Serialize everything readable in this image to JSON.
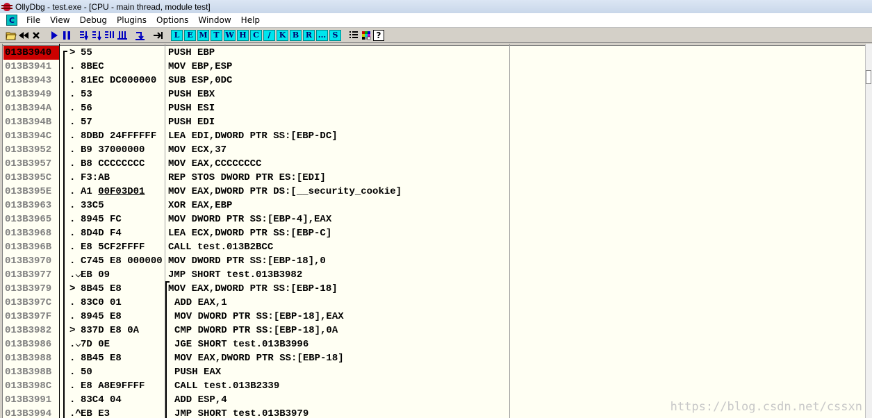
{
  "window": {
    "title": "OllyDbg - test.exe - [CPU - main thread, module test]"
  },
  "menu": {
    "logo": "C",
    "items": [
      "File",
      "View",
      "Debug",
      "Plugins",
      "Options",
      "Window",
      "Help"
    ]
  },
  "toolbar": {
    "icons": [
      "open-icon",
      "restart-icon",
      "close-icon",
      "run-icon",
      "pause-icon",
      "step-into-icon",
      "step-over-icon",
      "trace-into-icon",
      "trace-over-icon",
      "execute-till-return-icon",
      "goto-icon"
    ],
    "letters": [
      "L",
      "E",
      "M",
      "T",
      "W",
      "H",
      "C",
      "/",
      "K",
      "B",
      "R",
      "...",
      "S"
    ],
    "right_icons": [
      "list-icon",
      "palette-icon",
      "help-icon"
    ]
  },
  "colors": {
    "accent_cyan": "#00e5ee",
    "selected_address_bg": "#cc0000",
    "pane_bg": "#fffff3"
  },
  "disassembly": {
    "rows": [
      {
        "addr": "013B3940",
        "mark": "r>",
        "hex": "55",
        "asm": "PUSH EBP",
        "selected": true
      },
      {
        "addr": "013B3941",
        "mark": ".",
        "hex": "8BEC",
        "asm": "MOV EBP,ESP"
      },
      {
        "addr": "013B3943",
        "mark": ".",
        "hex": "81EC DC000000",
        "asm": "SUB ESP,0DC"
      },
      {
        "addr": "013B3949",
        "mark": ".",
        "hex": "53",
        "asm": "PUSH EBX"
      },
      {
        "addr": "013B394A",
        "mark": ".",
        "hex": "56",
        "asm": "PUSH ESI"
      },
      {
        "addr": "013B394B",
        "mark": ".",
        "hex": "57",
        "asm": "PUSH EDI"
      },
      {
        "addr": "013B394C",
        "mark": ".",
        "hex": "8DBD 24FFFFFF",
        "asm": "LEA EDI,DWORD PTR SS:[EBP-DC]"
      },
      {
        "addr": "013B3952",
        "mark": ".",
        "hex": "B9 37000000",
        "asm": "MOV ECX,37"
      },
      {
        "addr": "013B3957",
        "mark": ".",
        "hex": "B8 CCCCCCCC",
        "asm": "MOV EAX,CCCCCCCC"
      },
      {
        "addr": "013B395C",
        "mark": ".",
        "hex": "F3:AB",
        "asm": "REP STOS DWORD PTR ES:[EDI]"
      },
      {
        "addr": "013B395E",
        "mark": ".",
        "hex": "A1 00F03D01",
        "asm": "MOV EAX,DWORD PTR DS:[__security_cookie]",
        "hex_underline": "00F03D01"
      },
      {
        "addr": "013B3963",
        "mark": ".",
        "hex": "33C5",
        "asm": "XOR EAX,EBP"
      },
      {
        "addr": "013B3965",
        "mark": ".",
        "hex": "8945 FC",
        "asm": "MOV DWORD PTR SS:[EBP-4],EAX"
      },
      {
        "addr": "013B3968",
        "mark": ".",
        "hex": "8D4D F4",
        "asm": "LEA ECX,DWORD PTR SS:[EBP-C]"
      },
      {
        "addr": "013B396B",
        "mark": ".",
        "hex": "E8 5CF2FFFF",
        "asm": "CALL test.013B2BCC"
      },
      {
        "addr": "013B3970",
        "mark": ".",
        "hex": "C745 E8 000000",
        "asm": "MOV DWORD PTR SS:[EBP-18],0"
      },
      {
        "addr": "013B3977",
        "mark": ".v",
        "hex": "EB 09",
        "asm": "JMP SHORT test.013B3982"
      },
      {
        "addr": "013B3979",
        "mark": ">",
        "hex": "8B45 E8",
        "asm": "MOV EAX,DWORD PTR SS:[EBP-18]"
      },
      {
        "addr": "013B397C",
        "mark": ".",
        "hex": "83C0 01",
        "asm": "ADD EAX,1"
      },
      {
        "addr": "013B397F",
        "mark": ".",
        "hex": "8945 E8",
        "asm": "MOV DWORD PTR SS:[EBP-18],EAX"
      },
      {
        "addr": "013B3982",
        "mark": ">",
        "hex": "837D E8 0A",
        "asm": "CMP DWORD PTR SS:[EBP-18],0A"
      },
      {
        "addr": "013B3986",
        "mark": ".v",
        "hex": "7D 0E",
        "asm": "JGE SHORT test.013B3996"
      },
      {
        "addr": "013B3988",
        "mark": ".",
        "hex": "8B45 E8",
        "asm": "MOV EAX,DWORD PTR SS:[EBP-18]"
      },
      {
        "addr": "013B398B",
        "mark": ".",
        "hex": "50",
        "asm": "PUSH EAX"
      },
      {
        "addr": "013B398C",
        "mark": ".",
        "hex": "E8 A8E9FFFF",
        "asm": "CALL test.013B2339"
      },
      {
        "addr": "013B3991",
        "mark": ".",
        "hex": "83C4 04",
        "asm": "ADD ESP,4"
      },
      {
        "addr": "013B3994",
        "mark": ".^",
        "hex": "EB E3",
        "asm": "JMP SHORT test.013B3979"
      }
    ]
  },
  "watermark": "https://blog.csdn.net/cssxn"
}
